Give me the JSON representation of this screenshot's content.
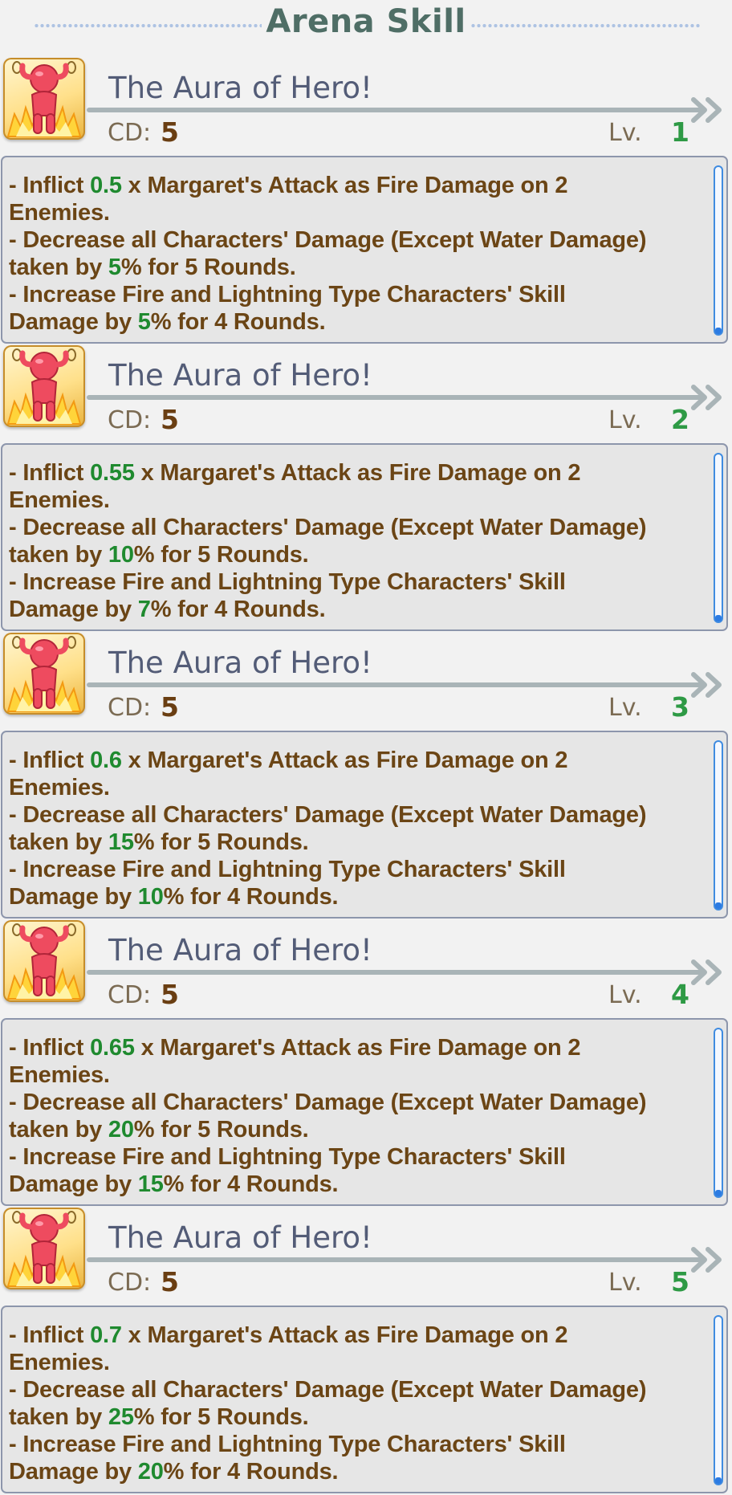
{
  "header": {
    "title": "Arena Skill"
  },
  "colors": {
    "accent_green": "#1f8a2f",
    "text_brown": "#6b4515",
    "name_slate": "#535c77"
  },
  "skill_icon": "hero-aura-icon",
  "labels": {
    "cd": "CD:",
    "lv": "Lv."
  },
  "skills": [
    {
      "name": "The Aura of Hero!",
      "cd": "5",
      "level": "1",
      "desc": {
        "l1_pre": "- Inflict ",
        "multiplier": "0.5",
        "l1_post": " x Margaret's Attack as Fire Damage on 2",
        "l2": "Enemies.",
        "l3": "- Decrease all Characters' Damage (Except Water Damage)",
        "l4_pre": "taken by ",
        "decrease": "5",
        "l4_post": "% for 5 Rounds.",
        "l5": "- Increase Fire and Lightning Type Characters' Skill",
        "l6_pre": "Damage by ",
        "increase": "5",
        "l6_post": "% for 4 Rounds."
      }
    },
    {
      "name": "The Aura of Hero!",
      "cd": "5",
      "level": "2",
      "desc": {
        "l1_pre": "- Inflict ",
        "multiplier": "0.55",
        "l1_post": " x Margaret's Attack as Fire Damage on 2",
        "l2": "Enemies.",
        "l3": "- Decrease all Characters' Damage (Except Water Damage)",
        "l4_pre": "taken by ",
        "decrease": "10",
        "l4_post": "% for 5 Rounds.",
        "l5": "- Increase Fire and Lightning Type Characters' Skill",
        "l6_pre": "Damage by ",
        "increase": "7",
        "l6_post": "% for 4 Rounds."
      }
    },
    {
      "name": "The Aura of Hero!",
      "cd": "5",
      "level": "3",
      "desc": {
        "l1_pre": "- Inflict ",
        "multiplier": "0.6",
        "l1_post": " x Margaret's Attack as Fire Damage on 2",
        "l2": "Enemies.",
        "l3": "- Decrease all Characters' Damage (Except Water Damage)",
        "l4_pre": "taken by ",
        "decrease": "15",
        "l4_post": "% for 5 Rounds.",
        "l5": "- Increase Fire and Lightning Type Characters' Skill",
        "l6_pre": "Damage by ",
        "increase": "10",
        "l6_post": "% for 4 Rounds."
      }
    },
    {
      "name": "The Aura of Hero!",
      "cd": "5",
      "level": "4",
      "desc": {
        "l1_pre": "- Inflict ",
        "multiplier": "0.65",
        "l1_post": " x Margaret's Attack as Fire Damage on 2",
        "l2": "Enemies.",
        "l3": "- Decrease all Characters' Damage (Except Water Damage)",
        "l4_pre": "taken by ",
        "decrease": "20",
        "l4_post": "% for 5 Rounds.",
        "l5": "- Increase Fire and Lightning Type Characters' Skill",
        "l6_pre": "Damage by ",
        "increase": "15",
        "l6_post": "% for 4 Rounds."
      }
    },
    {
      "name": "The Aura of Hero!",
      "cd": "5",
      "level": "5",
      "desc": {
        "l1_pre": "- Inflict ",
        "multiplier": "0.7",
        "l1_post": " x Margaret's Attack as Fire Damage on 2",
        "l2": "Enemies.",
        "l3": "- Decrease all Characters' Damage (Except Water Damage)",
        "l4_pre": "taken by ",
        "decrease": "25",
        "l4_post": "% for 5 Rounds.",
        "l5": "- Increase Fire and Lightning Type Characters' Skill",
        "l6_pre": "Damage by ",
        "increase": "20",
        "l6_post": "% for 4 Rounds."
      }
    }
  ]
}
